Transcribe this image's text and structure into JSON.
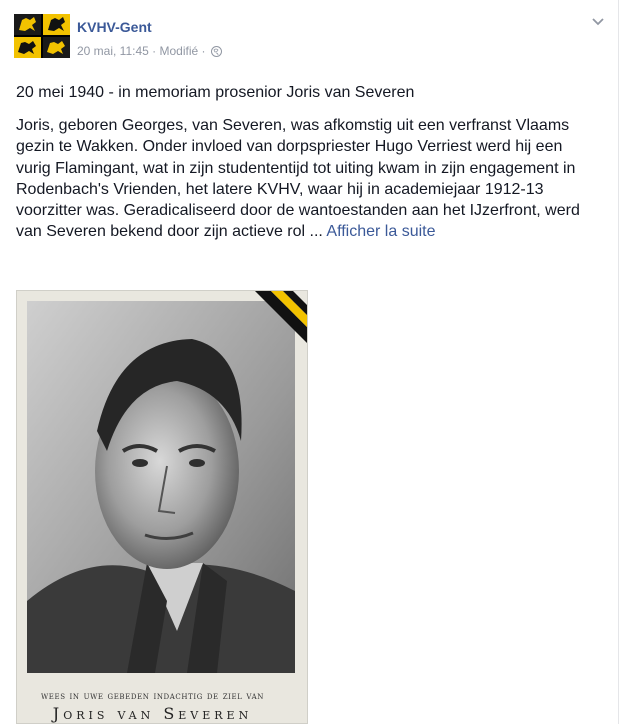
{
  "post": {
    "page_name": "KVHV-Gent",
    "timestamp": "20 mai, 11:45",
    "separator": "·",
    "edited_label": "Modifié",
    "headline": "20 mei 1940 - in memoriam prosenior Joris van Severen",
    "body_text": "Joris, geboren Georges, van Severen, was afkomstig uit een verfranst Vlaams gezin te Wakken. Onder invloed van dorpspriester Hugo Verriest werd hij een vurig Flamingant, wat in zijn studententijd tot uiting kwam in zijn engagement in Rodenbach's Vrienden, het latere KVHV, waar hij in academiejaar 1912-13 voorzitter was. Geradicaliseerd door de wantoestanden aan het IJzerfront, werd van Severen bekend door zijn actieve rol ...",
    "see_more_label": "Afficher la suite",
    "options_icon": "chevron-down-icon",
    "audience_icon": "globe-icon"
  },
  "photo": {
    "caption_line1": "wees in uwe gebeden indachtig de ziel van",
    "caption_line2": "Joris van Severen",
    "ribbon_colors": [
      "#000000",
      "#f2c200"
    ]
  }
}
